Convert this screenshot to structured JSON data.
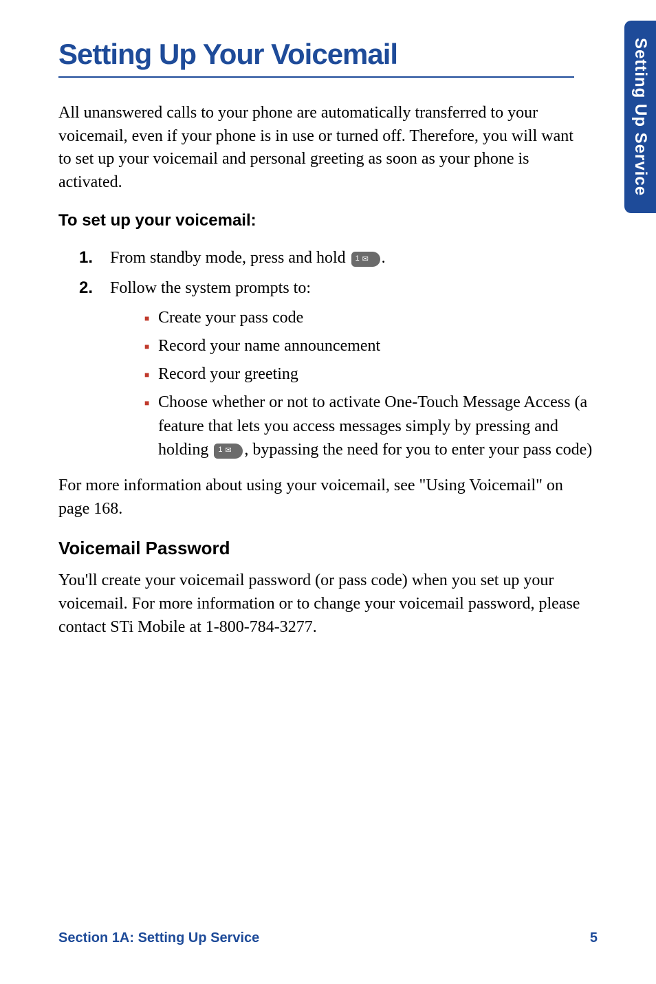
{
  "sideTab": "Setting Up Service",
  "mainHeading": "Setting Up Your Voicemail",
  "intro": "All unanswered calls to your phone are automatically transferred to your voicemail, even if your phone is in use or turned off. Therefore, you will want to set up your voicemail and personal greeting as soon as your phone is activated.",
  "instruction": "To set up your voicemail:",
  "steps": {
    "item1": {
      "num": "1.",
      "textBefore": "From standby mode, press and hold ",
      "textAfter": "."
    },
    "item2": {
      "num": "2.",
      "text": "Follow the system prompts to:"
    }
  },
  "bullets": {
    "b1": "Create your pass code",
    "b2": "Record your name announcement",
    "b3": "Record your greeting",
    "b4_before": "Choose whether or not to activate One-Touch Message Access (a feature that lets you access messages simply by pressing and holding ",
    "b4_after": ", bypassing the need for you to enter your pass code)"
  },
  "moreInfo": "For more information about using your voicemail, see \"Using Voicemail\" on page 168.",
  "subHeading": "Voicemail Password",
  "passwordText": "You'll create your voicemail password (or pass code) when you set up your voicemail. For more information or to change your voicemail password, please contact STi Mobile at 1-800-784-3277.",
  "footer": {
    "left": "Section 1A: Setting Up Service",
    "right": "5"
  }
}
